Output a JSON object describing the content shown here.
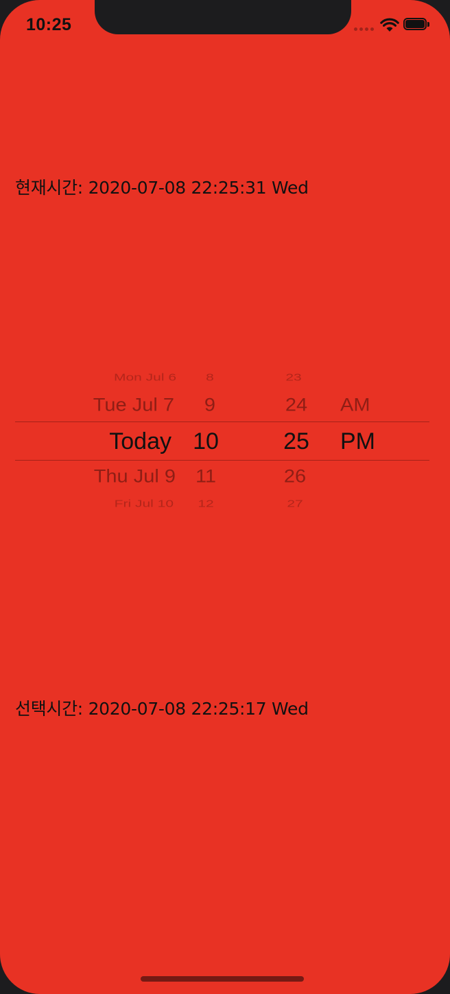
{
  "status_bar": {
    "time": "10:25"
  },
  "current_time": {
    "text": "현재시간: 2020-07-08 22:25:31 Wed"
  },
  "picker": {
    "day_column": [
      "Mon Jul 6",
      "Tue Jul 7",
      "Today",
      "Thu Jul 9",
      "Fri Jul 10"
    ],
    "hour_column": [
      "8",
      "9",
      "10",
      "11",
      "12"
    ],
    "minute_column": [
      "23",
      "24",
      "25",
      "26",
      "27"
    ],
    "ampm_column": [
      "",
      "AM",
      "PM",
      "",
      ""
    ],
    "selected": {
      "day": "Today",
      "hour": "10",
      "minute": "25",
      "ampm": "PM"
    }
  },
  "selected_time": {
    "text": "선택시간: 2020-07-08 22:25:17 Wed"
  },
  "colors": {
    "background": "#e83224",
    "text": "#111111",
    "frame": "#1c1c1e"
  }
}
